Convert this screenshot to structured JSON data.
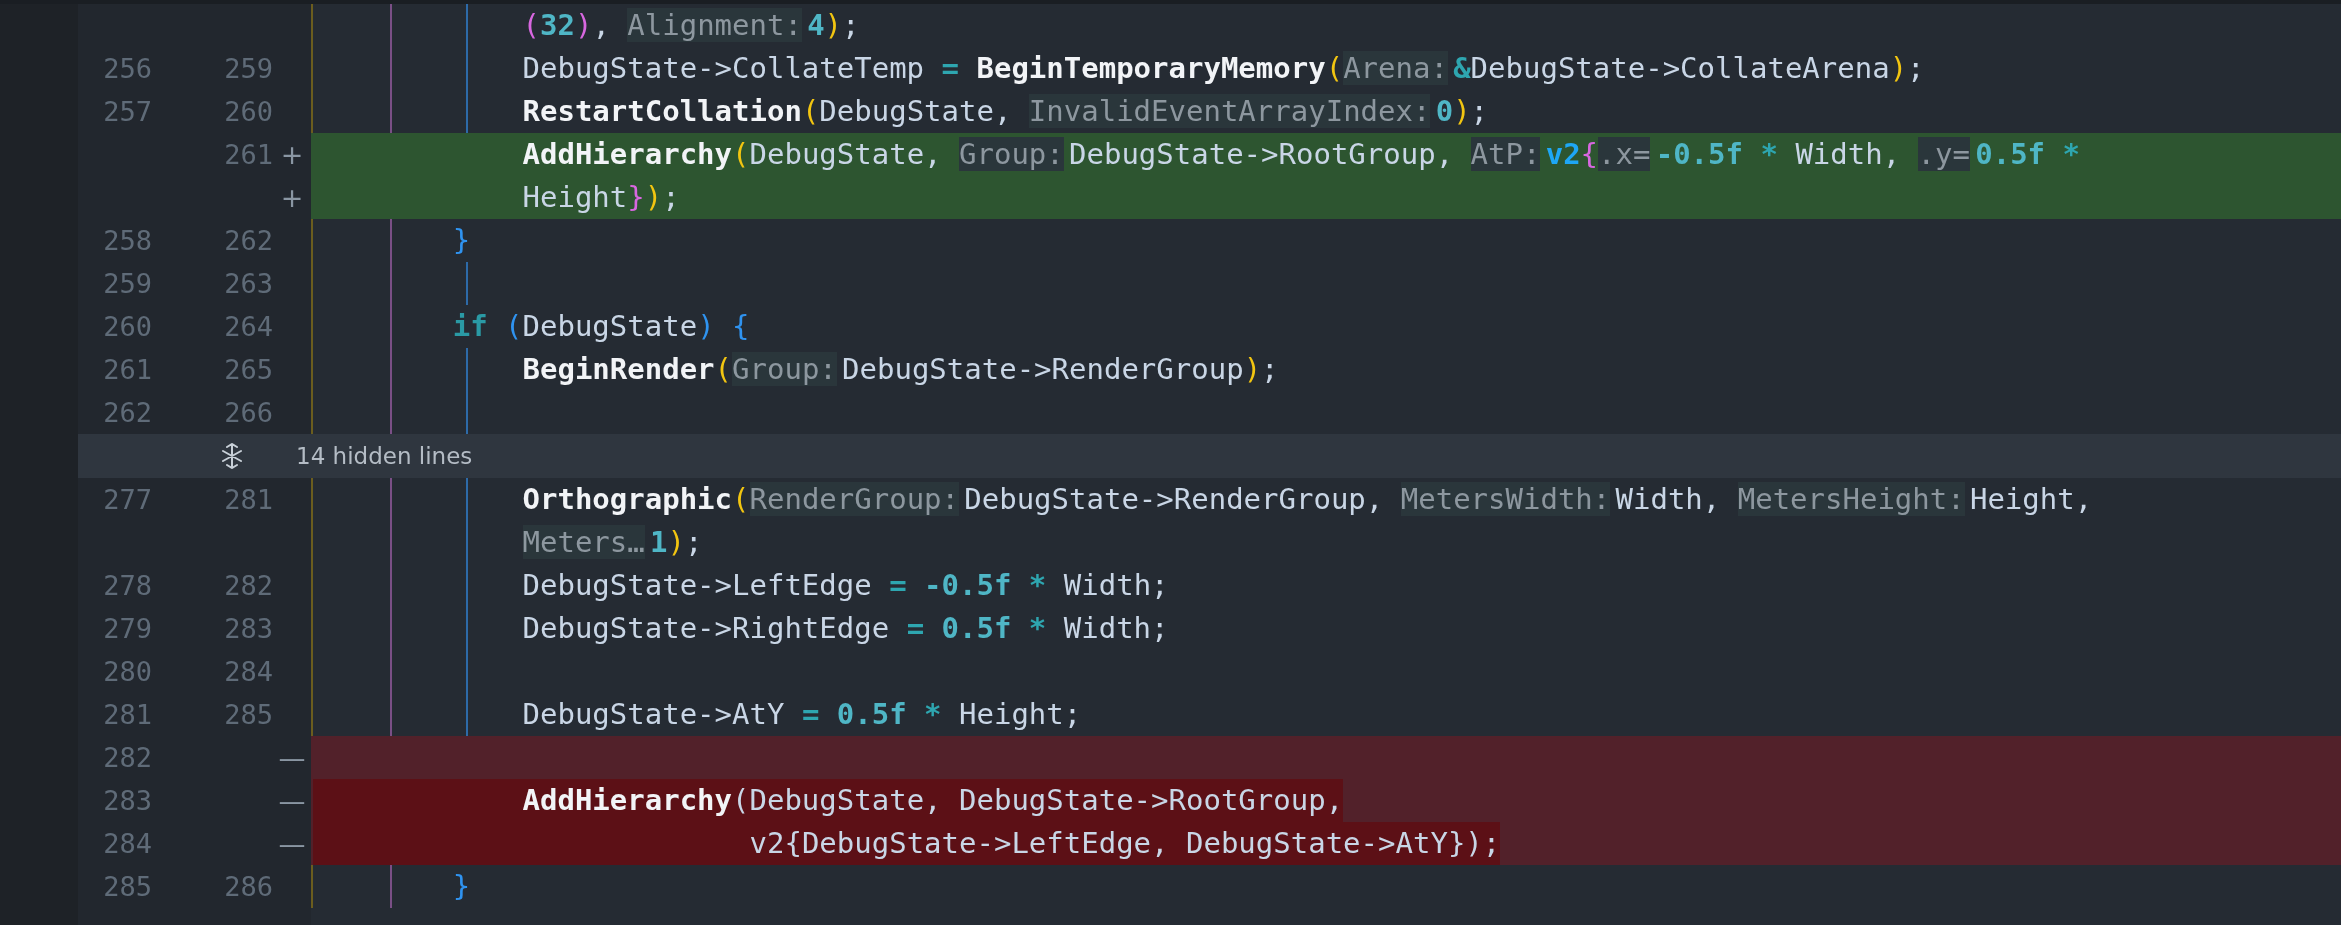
{
  "diff_view": {
    "rows": [
      {
        "kind": "context",
        "old": "",
        "new": "",
        "mark": "",
        "tokens": [
          {
            "kind": "paren_pink",
            "text": "            ("
          },
          {
            "kind": "num",
            "text": "32"
          },
          {
            "kind": "paren_pink",
            "text": ")"
          },
          {
            "kind": "plain",
            "text": ", "
          },
          {
            "kind": "hint",
            "text": "Alignment:"
          },
          {
            "kind": "num",
            "text": "4"
          },
          {
            "kind": "paren",
            "text": ")"
          },
          {
            "kind": "plain",
            "text": ";"
          }
        ]
      },
      {
        "kind": "context",
        "old": "256",
        "new": "259",
        "mark": "",
        "tokens": [
          {
            "kind": "plain",
            "text": "            DebugState->CollateTemp "
          },
          {
            "kind": "op",
            "text": "= "
          },
          {
            "kind": "fn",
            "text": "BeginTemporaryMemory"
          },
          {
            "kind": "paren",
            "text": "("
          },
          {
            "kind": "hint",
            "text": "Arena:"
          },
          {
            "kind": "op",
            "text": "&"
          },
          {
            "kind": "plain",
            "text": "DebugState->CollateArena"
          },
          {
            "kind": "paren",
            "text": ")"
          },
          {
            "kind": "plain",
            "text": ";"
          }
        ]
      },
      {
        "kind": "context",
        "old": "257",
        "new": "260",
        "mark": "",
        "tokens": [
          {
            "kind": "fn",
            "text": "            RestartCollation"
          },
          {
            "kind": "paren",
            "text": "("
          },
          {
            "kind": "plain",
            "text": "DebugState, "
          },
          {
            "kind": "hint",
            "text": "InvalidEventArrayIndex:"
          },
          {
            "kind": "num",
            "text": "0"
          },
          {
            "kind": "paren",
            "text": ")"
          },
          {
            "kind": "plain",
            "text": ";"
          }
        ]
      },
      {
        "kind": "added",
        "old": "",
        "new": "261",
        "mark": "+",
        "tokens": [
          {
            "kind": "fn",
            "text": "            AddHierarchy"
          },
          {
            "kind": "paren",
            "text": "("
          },
          {
            "kind": "plain",
            "text": "DebugState, "
          },
          {
            "kind": "hint",
            "text": "Group:"
          },
          {
            "kind": "plain",
            "text": "DebugState->RootGroup, "
          },
          {
            "kind": "hint",
            "text": "AtP:"
          },
          {
            "kind": "type",
            "text": "v2"
          },
          {
            "kind": "paren_pink",
            "text": "{"
          },
          {
            "kind": "hint",
            "text": ".x="
          },
          {
            "kind": "num",
            "text": "-0.5f"
          },
          {
            "kind": "op",
            "text": " * "
          },
          {
            "kind": "plain",
            "text": "Width, "
          },
          {
            "kind": "hint",
            "text": ".y="
          },
          {
            "kind": "num",
            "text": "0.5f"
          },
          {
            "kind": "op",
            "text": " *"
          }
        ]
      },
      {
        "kind": "added",
        "old": "",
        "new": "",
        "mark": "+",
        "tokens": [
          {
            "kind": "plain",
            "text": "            Height"
          },
          {
            "kind": "paren_pink",
            "text": "}"
          },
          {
            "kind": "paren",
            "text": ")"
          },
          {
            "kind": "plain",
            "text": ";"
          }
        ]
      },
      {
        "kind": "context",
        "old": "258",
        "new": "262",
        "mark": "",
        "tokens": [
          {
            "kind": "brace",
            "text": "        }"
          }
        ]
      },
      {
        "kind": "context",
        "old": "259",
        "new": "263",
        "mark": "",
        "tokens": []
      },
      {
        "kind": "context",
        "old": "260",
        "new": "264",
        "mark": "",
        "tokens": [
          {
            "kind": "keyword",
            "text": "        if"
          },
          {
            "kind": "brace",
            "text": " ("
          },
          {
            "kind": "plain",
            "text": "DebugState"
          },
          {
            "kind": "brace",
            "text": ")"
          },
          {
            "kind": "brace",
            "text": " {"
          }
        ]
      },
      {
        "kind": "context",
        "old": "261",
        "new": "265",
        "mark": "",
        "tokens": [
          {
            "kind": "fn",
            "text": "            BeginRender"
          },
          {
            "kind": "paren",
            "text": "("
          },
          {
            "kind": "hint",
            "text": "Group:"
          },
          {
            "kind": "plain",
            "text": "DebugState->RenderGroup"
          },
          {
            "kind": "paren",
            "text": ")"
          },
          {
            "kind": "plain",
            "text": ";"
          }
        ]
      },
      {
        "kind": "context",
        "old": "262",
        "new": "266",
        "mark": "",
        "tokens": []
      },
      {
        "kind": "fold",
        "label": "14 hidden lines"
      },
      {
        "kind": "context",
        "old": "277",
        "new": "281",
        "mark": "",
        "tokens": [
          {
            "kind": "fn",
            "text": "            Orthographic"
          },
          {
            "kind": "paren",
            "text": "("
          },
          {
            "kind": "hint",
            "text": "RenderGroup:"
          },
          {
            "kind": "plain",
            "text": "DebugState->RenderGroup, "
          },
          {
            "kind": "hint",
            "text": "MetersWidth:"
          },
          {
            "kind": "plain",
            "text": "Width, "
          },
          {
            "kind": "hint",
            "text": "MetersHeight:"
          },
          {
            "kind": "plain",
            "text": "Height,"
          }
        ]
      },
      {
        "kind": "context",
        "old": "",
        "new": "",
        "mark": "",
        "tokens": [
          {
            "kind": "hint",
            "text": "            Meters…"
          },
          {
            "kind": "num",
            "text": "1"
          },
          {
            "kind": "paren",
            "text": ")"
          },
          {
            "kind": "plain",
            "text": ";"
          }
        ]
      },
      {
        "kind": "context",
        "old": "278",
        "new": "282",
        "mark": "",
        "tokens": [
          {
            "kind": "plain",
            "text": "            DebugState->LeftEdge "
          },
          {
            "kind": "op",
            "text": "= "
          },
          {
            "kind": "num",
            "text": "-0.5f"
          },
          {
            "kind": "op",
            "text": " * "
          },
          {
            "kind": "plain",
            "text": "Width;"
          }
        ]
      },
      {
        "kind": "context",
        "old": "279",
        "new": "283",
        "mark": "",
        "tokens": [
          {
            "kind": "plain",
            "text": "            DebugState->RightEdge "
          },
          {
            "kind": "op",
            "text": "= "
          },
          {
            "kind": "num",
            "text": "0.5f"
          },
          {
            "kind": "op",
            "text": " * "
          },
          {
            "kind": "plain",
            "text": "Width;"
          }
        ]
      },
      {
        "kind": "context",
        "old": "280",
        "new": "284",
        "mark": "",
        "tokens": []
      },
      {
        "kind": "context",
        "old": "281",
        "new": "285",
        "mark": "",
        "tokens": [
          {
            "kind": "plain",
            "text": "            DebugState->AtY "
          },
          {
            "kind": "op",
            "text": "= "
          },
          {
            "kind": "num",
            "text": "0.5f"
          },
          {
            "kind": "op",
            "text": " * "
          },
          {
            "kind": "plain",
            "text": "Height;"
          }
        ]
      },
      {
        "kind": "removed",
        "old": "282",
        "new": "",
        "mark": "—",
        "tokens": []
      },
      {
        "kind": "removed",
        "old": "283",
        "new": "",
        "mark": "—",
        "tokens": [
          {
            "kind": "fn",
            "text": "            AddHierarchy"
          },
          {
            "kind": "plain",
            "text": "(DebugState, DebugState->RootGroup,"
          }
        ]
      },
      {
        "kind": "removed",
        "old": "284",
        "new": "",
        "mark": "—",
        "tokens": [
          {
            "kind": "plain",
            "text": "                         v2{DebugState->LeftEdge, DebugState->AtY});"
          }
        ]
      },
      {
        "kind": "context",
        "old": "285",
        "new": "286",
        "mark": "",
        "tokens": [
          {
            "kind": "brace",
            "text": "        }"
          }
        ]
      }
    ]
  }
}
